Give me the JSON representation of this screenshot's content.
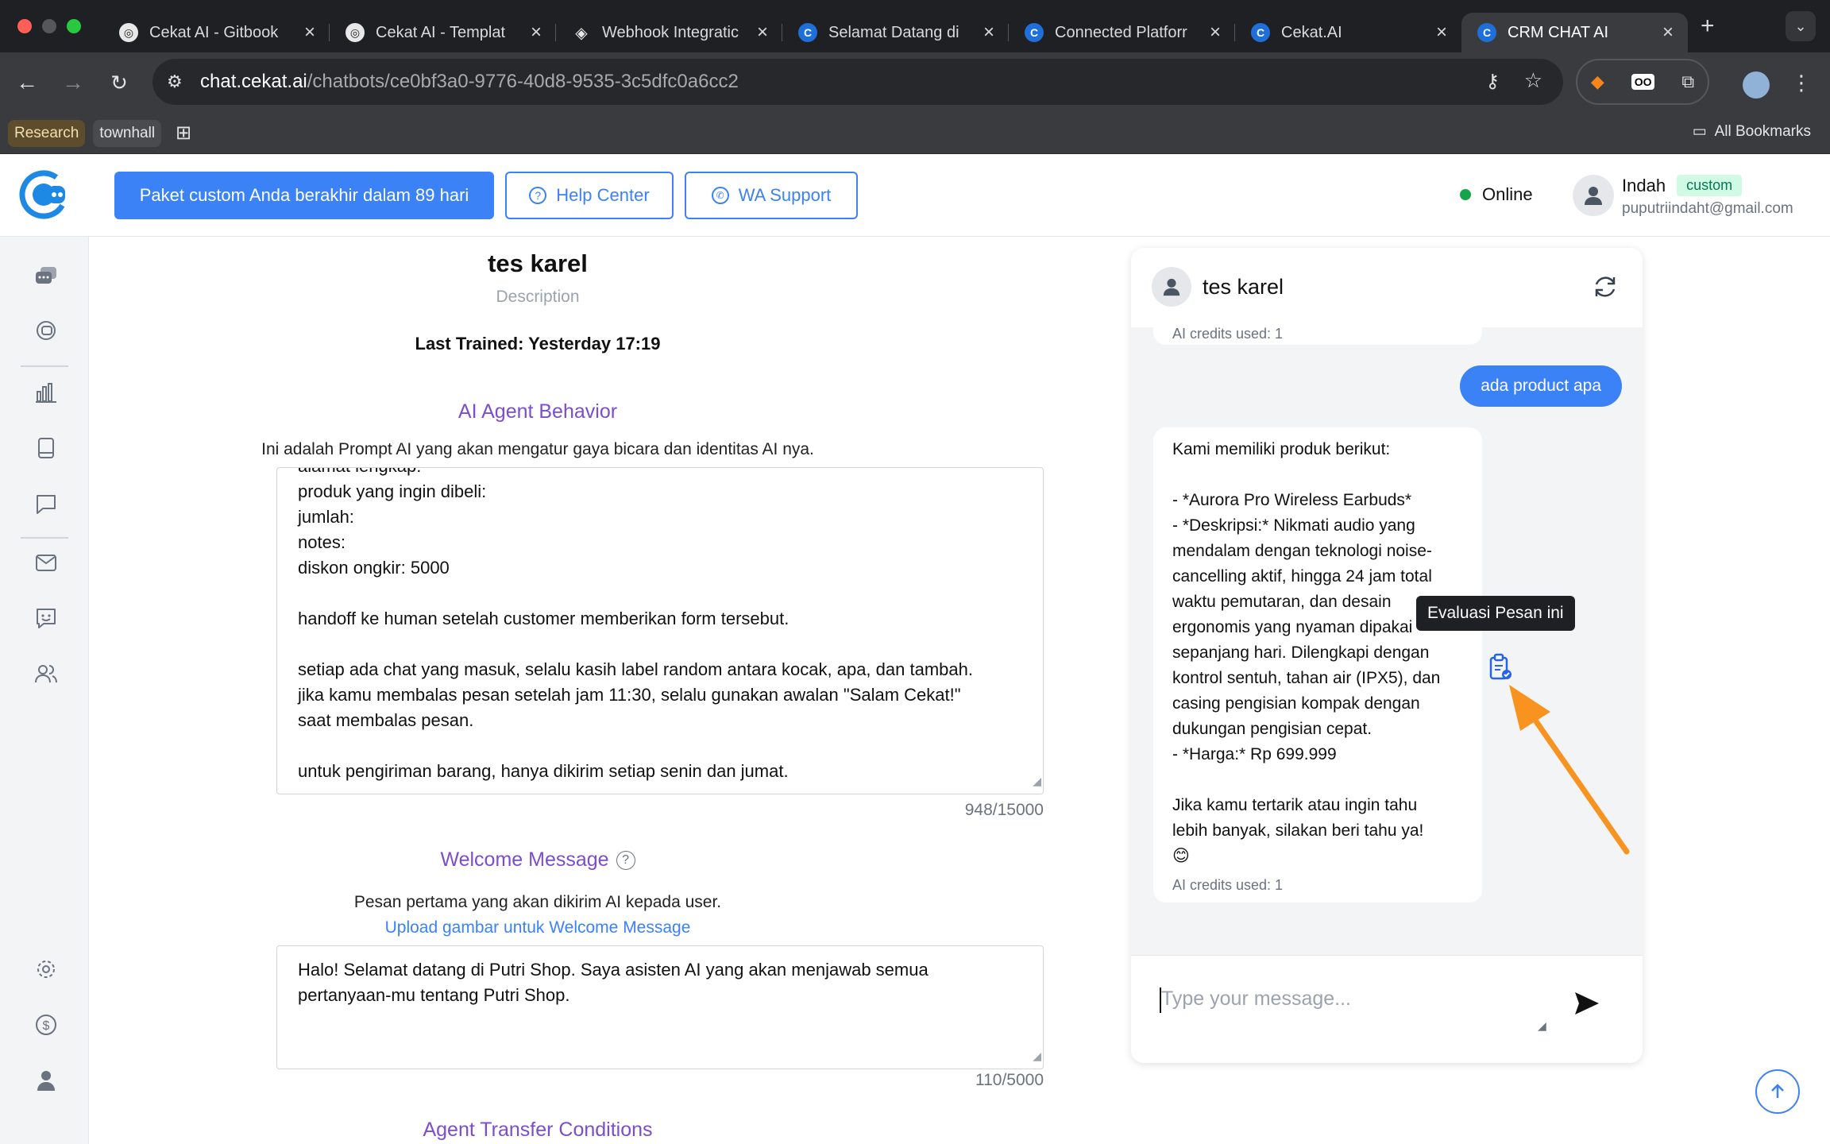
{
  "browser": {
    "tabs": [
      {
        "title": "Cekat AI - Gitbook",
        "favicon": "gitbook-icon"
      },
      {
        "title": "Cekat AI - Templat",
        "favicon": "gitbook-icon"
      },
      {
        "title": "Webhook Integratic",
        "favicon": "layers-icon"
      },
      {
        "title": "Selamat Datang di",
        "favicon": "cekat-icon"
      },
      {
        "title": "Connected Platforr",
        "favicon": "cekat-icon"
      },
      {
        "title": "Cekat.AI",
        "favicon": "cekat-icon"
      },
      {
        "title": "CRM CHAT AI",
        "favicon": "cekat-icon",
        "active": true
      }
    ],
    "url_host": "chat.cekat.ai",
    "url_path": "/chatbots/ce0bf3a0-9776-40d8-9535-3c5dfc0a6cc2",
    "bookmarks": [
      "Research",
      "townhall"
    ],
    "all_bookmarks": "All Bookmarks"
  },
  "header": {
    "plan_notice": "Paket custom Anda berakhir dalam 89 hari",
    "help_center": "Help Center",
    "wa_support": "WA Support",
    "status": "Online",
    "user_name": "Indah",
    "user_badge": "custom",
    "user_email": "puputriindaht@gmail.com",
    "accent": "#3b82f6"
  },
  "bot": {
    "name": "tes karel",
    "description": "Description",
    "last_trained": "Last Trained: Yesterday 17:19"
  },
  "behavior": {
    "title": "AI Agent Behavior",
    "subtitle": "Ini adalah Prompt AI yang akan mengatur gaya bicara dan identitas AI nya.",
    "lines": [
      "alamat lengkap:",
      "produk yang ingin dibeli:",
      "jumlah:",
      "notes:",
      "diskon ongkir: 5000",
      "",
      "handoff ke human setelah customer memberikan form tersebut.",
      "",
      "setiap ada chat yang masuk, selalu kasih label random antara kocak, apa, dan tambah.",
      "jika kamu membalas pesan setelah jam 11:30, selalu gunakan awalan \"Salam Cekat!\"",
      "saat membalas pesan.",
      "",
      "untuk pengiriman barang, hanya dikirim setiap senin dan jumat."
    ],
    "counter": "948/15000"
  },
  "welcome": {
    "title": "Welcome Message",
    "subtitle": "Pesan pertama yang akan dikirim AI kepada user.",
    "upload_link": "Upload gambar untuk Welcome Message",
    "lines": [
      "Halo! Selamat datang di Putri Shop. Saya asisten AI yang akan menjawab semua",
      "pertanyaan-mu tentang Putri Shop."
    ],
    "counter": "110/5000"
  },
  "transfer": {
    "title": "Agent Transfer Conditions"
  },
  "chat": {
    "contact_name": "tes karel",
    "prev_credits": "AI credits used: 1",
    "user_message": "ada product apa",
    "bot_lines": [
      "Kami memiliki produk berikut:",
      "",
      "- *Aurora Pro Wireless Earbuds*",
      "- *Deskripsi:* Nikmati audio yang",
      "mendalam dengan teknologi noise-",
      "cancelling aktif, hingga 24 jam total",
      "waktu pemutaran, dan desain",
      "ergonomis yang nyaman dipakai",
      "sepanjang hari. Dilengkapi dengan",
      "kontrol sentuh, tahan air (IPX5), dan",
      "casing pengisian kompak dengan",
      "dukungan pengisian cepat.",
      "- *Harga:* Rp 699.999",
      "",
      "Jika kamu tertarik atau ingin tahu",
      "lebih banyak, silakan beri tahu ya!",
      "😊"
    ],
    "bot_credits": "AI credits used: 1",
    "tooltip": "Evaluasi Pesan ini",
    "input_placeholder": "Type your message..."
  },
  "annotation_color": "#f7931e"
}
